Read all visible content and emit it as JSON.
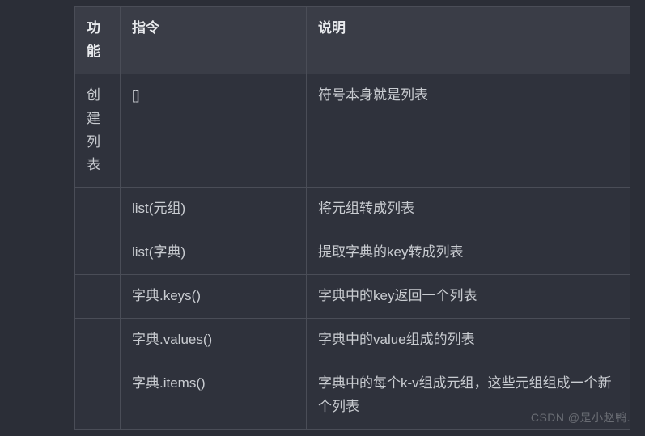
{
  "table": {
    "headers": {
      "func": "功能",
      "cmd": "指令",
      "desc": "说明"
    },
    "rows": [
      {
        "func": "创建列表",
        "cmd": "[]",
        "desc": "符号本身就是列表"
      },
      {
        "func": "",
        "cmd": "list(元组)",
        "desc": "将元组转成列表"
      },
      {
        "func": "",
        "cmd": "list(字典)",
        "desc": "提取字典的key转成列表"
      },
      {
        "func": "",
        "cmd": "字典.keys()",
        "desc": "字典中的key返回一个列表"
      },
      {
        "func": "",
        "cmd": "字典.values()",
        "desc": "字典中的value组成的列表"
      },
      {
        "func": "",
        "cmd": "字典.items()",
        "desc": "字典中的每个k-v组成元组，这些元组组成一个新个列表"
      }
    ]
  },
  "watermark": "CSDN @是小赵鸭."
}
